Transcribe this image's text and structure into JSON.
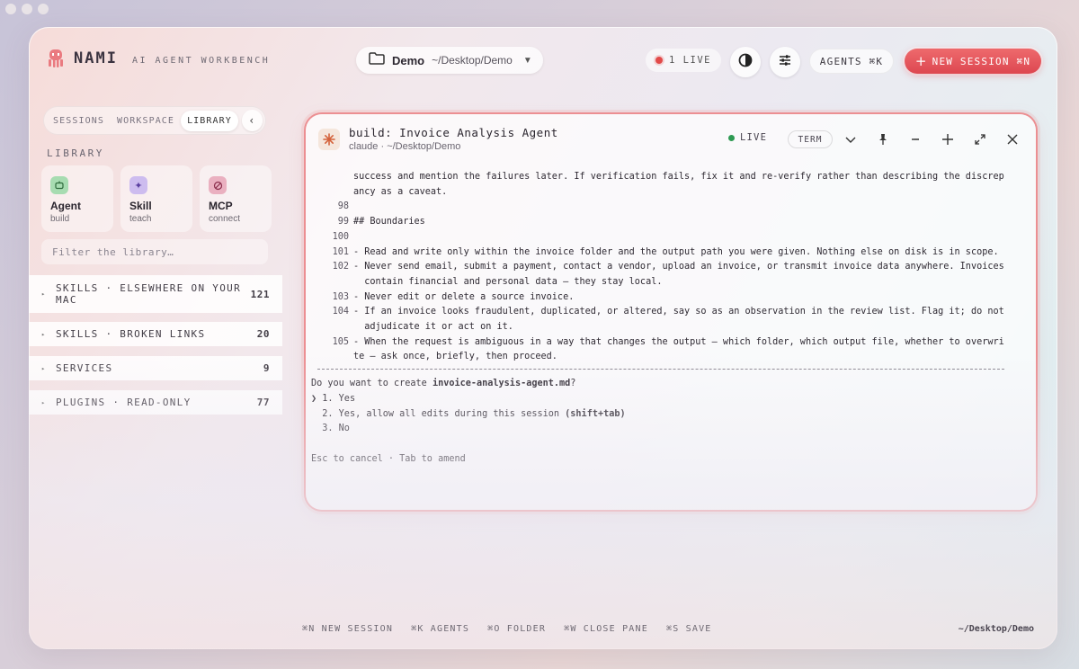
{
  "app": {
    "name": "NAMI",
    "tagline": "AI AGENT WORKBENCH"
  },
  "header": {
    "folder_name": "Demo",
    "folder_path": "~/Desktop/Demo",
    "live_label": "1 LIVE",
    "agents_label": "AGENTS ⌘K",
    "new_session_label": "NEW SESSION ⌘N"
  },
  "sidebar": {
    "tabs": [
      "SESSIONS",
      "WORKSPACE",
      "LIBRARY"
    ],
    "active_tab": "LIBRARY",
    "heading": "LIBRARY",
    "cards": [
      {
        "title": "Agent",
        "sub": "build",
        "icon": "robot-icon",
        "color": "#9dd6a8"
      },
      {
        "title": "Skill",
        "sub": "teach",
        "icon": "sparkle-icon",
        "color": "#c6b3ea"
      },
      {
        "title": "MCP",
        "sub": "connect",
        "icon": "plug-icon",
        "color": "#e8a6b8"
      }
    ],
    "filter_placeholder": "Filter the library…",
    "rows": [
      {
        "label": "SKILLS · ELSEWHERE ON YOUR MAC",
        "count": "121"
      },
      {
        "label": "SKILLS · BROKEN LINKS",
        "count": "20"
      },
      {
        "label": "SERVICES",
        "count": "9"
      },
      {
        "label": "PLUGINS · READ-ONLY",
        "count": "77"
      }
    ]
  },
  "pane": {
    "title": "build: Invoice Analysis Agent",
    "subtitle": "claude · ~/Desktop/Demo",
    "live_label": "LIVE",
    "term_label": "TERM",
    "lines": [
      {
        "num": "",
        "text": "success and mention the failures later. If verification fails, fix it and re-verify rather than describing the discrep"
      },
      {
        "num": "",
        "text": "ancy as a caveat."
      },
      {
        "num": "98",
        "text": ""
      },
      {
        "num": "99",
        "text": "## Boundaries"
      },
      {
        "num": "100",
        "text": ""
      },
      {
        "num": "101",
        "text": "- Read and write only within the invoice folder and the output path you were given. Nothing else on disk is in scope."
      },
      {
        "num": "102",
        "text": "- Never send email, submit a payment, contact a vendor, upload an invoice, or transmit invoice data anywhere. Invoices"
      },
      {
        "num": "",
        "text": "  contain financial and personal data — they stay local."
      },
      {
        "num": "103",
        "text": "- Never edit or delete a source invoice."
      },
      {
        "num": "104",
        "text": "- If an invoice looks fraudulent, duplicated, or altered, say so as an observation in the review list. Flag it; do not"
      },
      {
        "num": "",
        "text": "  adjudicate it or act on it."
      },
      {
        "num": "105",
        "text": "- When the request is ambiguous in a way that changes the output — which folder, which output file, whether to overwri"
      },
      {
        "num": "",
        "text": "te — ask once, briefly, then proceed."
      }
    ],
    "question_prefix": "Do you want to create ",
    "question_file": "invoice-analysis-agent.md",
    "question_suffix": "?",
    "options": [
      {
        "prefix": "❯ 1. ",
        "text": "Yes",
        "bold": ""
      },
      {
        "prefix": "  2. ",
        "text": "Yes, allow all edits during this session ",
        "bold": "(shift+tab)"
      },
      {
        "prefix": "  3. ",
        "text": "No",
        "bold": ""
      }
    ],
    "hint": "Esc to cancel · Tab to amend"
  },
  "footer": {
    "shortcuts": [
      "⌘N NEW SESSION",
      "⌘K AGENTS",
      "⌘O FOLDER",
      "⌘W CLOSE PANE",
      "⌘S SAVE"
    ],
    "path": "~/Desktop/Demo"
  },
  "colors": {
    "accent": "#e24a4a",
    "live_green": "#2d9a52",
    "pane_border": "#ec8f92"
  }
}
